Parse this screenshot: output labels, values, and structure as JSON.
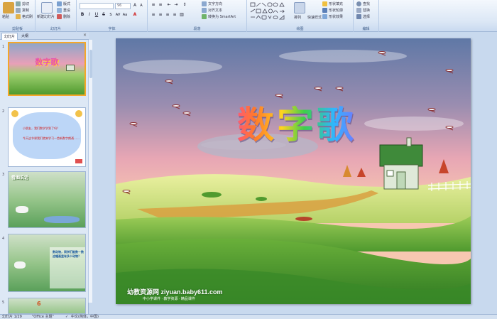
{
  "ribbon": {
    "clipboard": {
      "paste": "粘贴",
      "cut": "剪切",
      "copy": "复制",
      "format_painter": "格式刷",
      "group": "剪贴板"
    },
    "slides": {
      "new_slide": "新建幻灯片",
      "layout": "版式",
      "reset": "重设",
      "delete": "删除",
      "group": "幻灯片"
    },
    "font": {
      "size_value": "96",
      "group": "字体"
    },
    "paragraph": {
      "text_direction": "文字方向",
      "align_text": "对齐文本",
      "convert_smartart": "转换为 SmartArt",
      "group": "段落"
    },
    "drawing": {
      "arrange": "排列",
      "quick_styles": "快速样式",
      "shape_fill": "形状填充",
      "shape_outline": "形状轮廓",
      "shape_effects": "形状效果",
      "group": "绘图"
    },
    "editing": {
      "find": "查找",
      "replace": "替换",
      "select": "选择",
      "group": "编辑"
    }
  },
  "pane": {
    "tabs": [
      "幻灯片",
      "大纲"
    ],
    "thumbnails": [
      {
        "number": "1",
        "title": "数字歌"
      },
      {
        "number": "2",
        "line1": "小朋友，我们数学学到了吗？",
        "line2": "今天这节课我们就来学习一首新数字朗诵……"
      },
      {
        "number": "3",
        "title": "看图说话"
      },
      {
        "number": "4",
        "text": "数动物，同学们能数一数这幅画里有多少动物？"
      },
      {
        "number": "5",
        "text": "6"
      }
    ]
  },
  "slide": {
    "title": "数字歌",
    "watermark": "幼教资源网 ziyuan.baby611.com",
    "watermark_sub": "中小学课件 · 教学资源 · 精品课件"
  },
  "status": {
    "slide_position": "幻灯片 1/29",
    "theme": "\"Office 主题\"",
    "language": "中文(简体，中国)"
  },
  "colors": {
    "ribbon_bg": "#dbe7f5",
    "accent": "#f4a72a"
  }
}
